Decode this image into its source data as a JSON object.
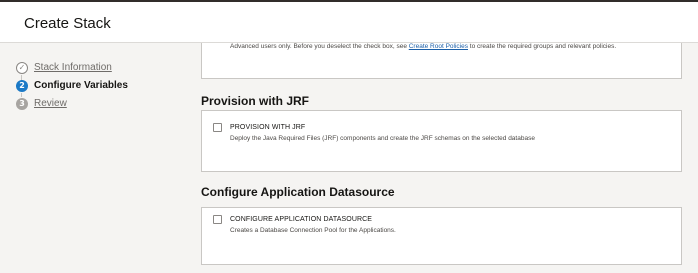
{
  "header": {
    "title": "Create Stack"
  },
  "steps": [
    {
      "number": "✓",
      "label": "Stack Information",
      "state": "done"
    },
    {
      "number": "2",
      "label": "Configure Variables",
      "state": "current"
    },
    {
      "number": "3",
      "label": "Review",
      "state": "future"
    }
  ],
  "top_panel": {
    "text_before": "Advanced users only. Before you deselect the check box, see ",
    "link": "Create Root Policies",
    "text_after": " to create the required groups and relevant policies."
  },
  "jrf_section": {
    "title": "Provision with JRF",
    "option_label": "PROVISION WITH JRF",
    "option_description": "Deploy the Java Required Files (JRF) components and create the JRF schemas on the selected database",
    "checked": false
  },
  "datasource_section": {
    "title": "Configure Application Datasource",
    "option_label": "CONFIGURE APPLICATION DATASOURCE",
    "option_description": "Creates a Database Connection Pool for the Applications.",
    "checked": false
  },
  "colors": {
    "accent": "#1b79c6",
    "background": "#f5f4f2",
    "panel": "#ffffff",
    "link": "#1b5fa8"
  }
}
